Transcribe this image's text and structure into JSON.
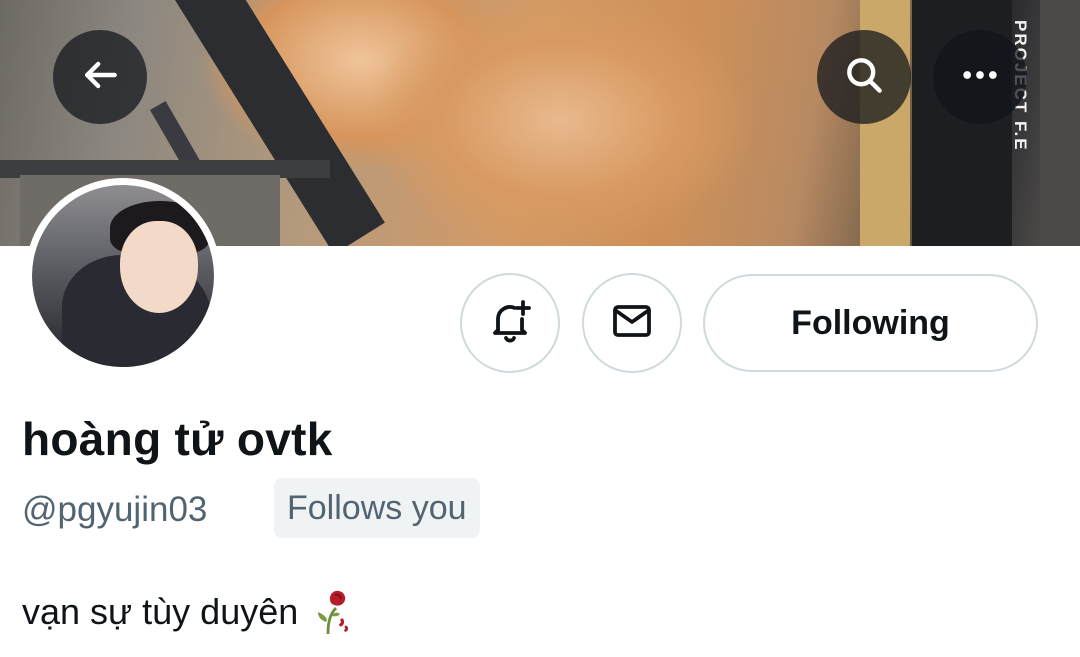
{
  "header": {
    "back_icon": "arrow-left-icon",
    "search_icon": "search-icon",
    "more_icon": "more-horizontal-icon",
    "banner_book_label": "PROJECT F.E"
  },
  "profile": {
    "display_name": "hoàng tử ovtk",
    "handle": "@pgyujin03",
    "follows_you": "Follows you",
    "bio": "vạn sự tùy duyên",
    "bio_emoji": "wilted-rose-icon"
  },
  "actions": {
    "notify_icon": "bell-plus-icon",
    "message_icon": "envelope-icon",
    "following_label": "Following"
  },
  "colors": {
    "text_primary": "#0f1419",
    "text_secondary": "#536471",
    "border": "#cfd9de",
    "badge_bg": "#eff3f4"
  }
}
